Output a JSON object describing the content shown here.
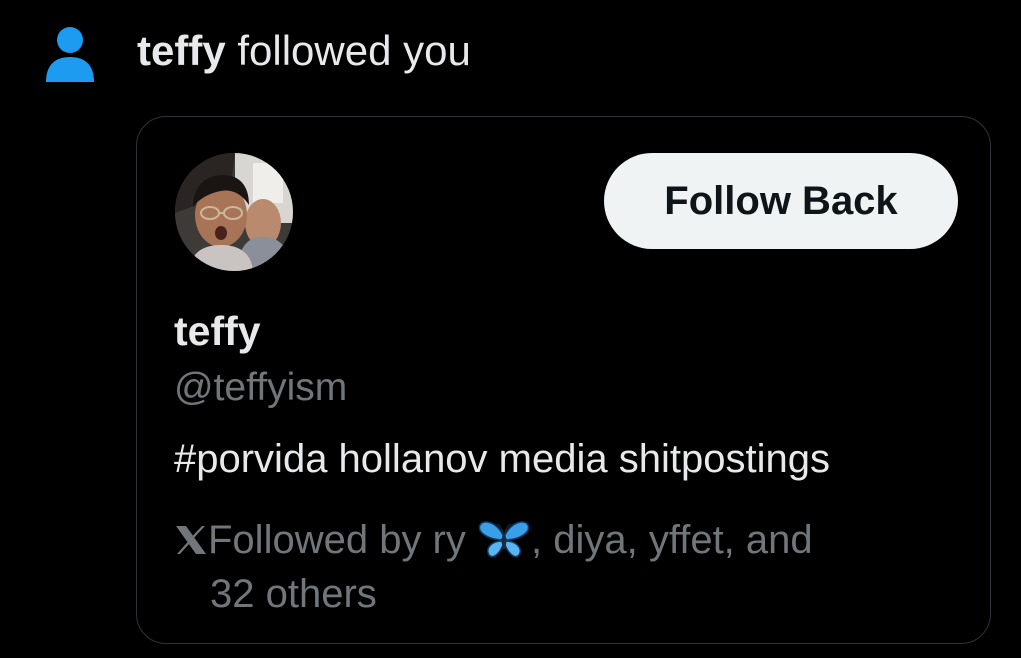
{
  "notification": {
    "user": "teffy",
    "action": " followed you",
    "icon": "person-icon",
    "icon_color": "#1d9bf0"
  },
  "profile_card": {
    "avatar": "profile-photo",
    "follow_back_label": "Follow Back",
    "display_name": "teffy",
    "handle": "@teffyism",
    "bio": "#porvida hollanov media shitpostings",
    "followed_by": {
      "icon": "x-logo-icon",
      "prefix": "Followed by ry ",
      "emoji": "butterfly",
      "rest": ", diya, yffet, and",
      "others": "32 others"
    }
  },
  "colors": {
    "background": "#000000",
    "primary_text": "#e7e9ea",
    "secondary_text": "#71767b",
    "border": "#2f3336",
    "button_bg": "#eff3f4",
    "button_text": "#0f1419",
    "accent": "#1d9bf0"
  }
}
